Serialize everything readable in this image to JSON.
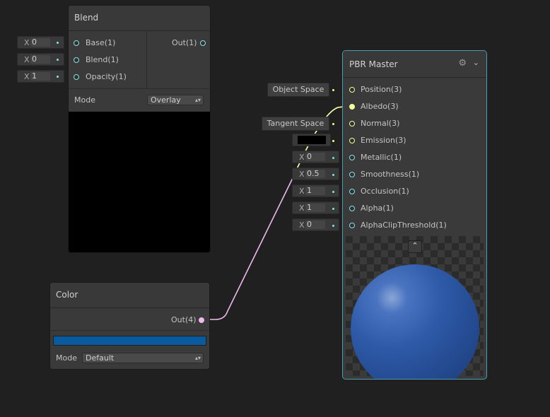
{
  "blend": {
    "title": "Blend",
    "inputs": [
      {
        "label": "Base(1)",
        "x": "X",
        "value": "0"
      },
      {
        "label": "Blend(1)",
        "x": "X",
        "value": "0"
      },
      {
        "label": "Opacity(1)",
        "x": "X",
        "value": "1"
      }
    ],
    "output": "Out(1)",
    "mode_label": "Mode",
    "mode_value": "Overlay"
  },
  "color_node": {
    "title": "Color",
    "output": "Out(4)",
    "swatch": "#0a5aa0",
    "mode_label": "Mode",
    "mode_value": "Default"
  },
  "pbr": {
    "title": "PBR Master",
    "inputs": [
      {
        "label": "Position(3)",
        "field": "Object Space"
      },
      {
        "label": "Albedo(3)",
        "field": ""
      },
      {
        "label": "Normal(3)",
        "field": "Tangent Space"
      },
      {
        "label": "Emission(3)",
        "field": ""
      },
      {
        "label": "Metallic(1)",
        "x": "X",
        "value": "0"
      },
      {
        "label": "Smoothness(1)",
        "x": "X",
        "value": "0.5"
      },
      {
        "label": "Occlusion(1)",
        "x": "X",
        "value": "1"
      },
      {
        "label": "Alpha(1)",
        "x": "X",
        "value": "1"
      },
      {
        "label": "AlphaClipThreshold(1)",
        "x": "X",
        "value": "0"
      }
    ],
    "preview_collapse_icon": "chevron-up-icon",
    "settings_icon": "gear-icon",
    "collapse_icon": "chevron-down-icon"
  },
  "colors": {
    "cyan_port": "#84e4e7",
    "yellow_port": "#f6ff9a",
    "pink_port": "#f0b9ee",
    "selection": "#4a9cb0",
    "sphere": "#2e5aa8"
  }
}
